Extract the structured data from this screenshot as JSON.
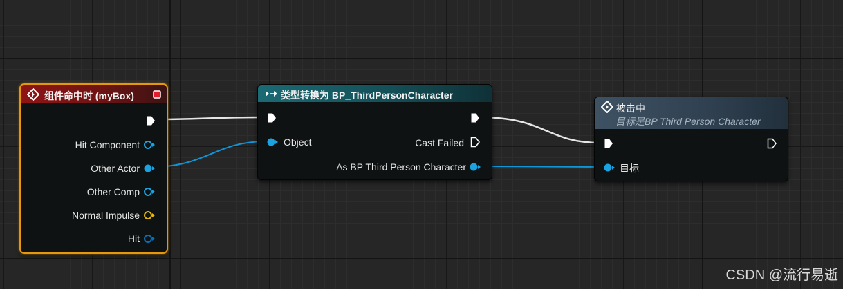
{
  "nodes": {
    "event": {
      "title": "组件命中时 (myBox)",
      "pins": {
        "hit_component": "Hit Component",
        "other_actor": "Other Actor",
        "other_comp": "Other Comp",
        "normal_impulse": "Normal Impulse",
        "hit": "Hit"
      }
    },
    "cast": {
      "title": "类型转换为 BP_ThirdPersonCharacter",
      "pins": {
        "object": "Object",
        "cast_failed": "Cast Failed",
        "as_bp": "As BP Third Person Character"
      }
    },
    "hit": {
      "title": "被击中",
      "subtitle": "目标是BP Third Person Character",
      "pins": {
        "target": "目标"
      }
    }
  },
  "colors": {
    "event_header": "#8f1414",
    "cast_header": "#1b6a74",
    "call_header": "#3e5263",
    "selection": "#e6980c",
    "object_pin": "#0ea5e9",
    "struct_pin": "#0b6fb8",
    "vector_pin": "#e5b80b",
    "exec_pin": "#ffffff"
  },
  "watermark": "CSDN @流行易逝"
}
